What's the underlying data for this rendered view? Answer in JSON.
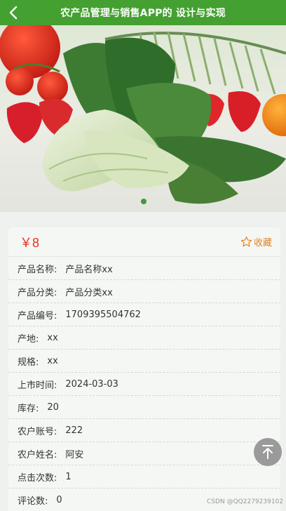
{
  "header": {
    "title": "农产品管理与销售APP的 设计与实现"
  },
  "product": {
    "price": "￥8",
    "favorite_label": "收藏"
  },
  "details": [
    {
      "label": "产品名称:",
      "value": "产品名称xx"
    },
    {
      "label": "产品分类:",
      "value": "产品分类xx"
    },
    {
      "label": "产品编号:",
      "value": "1709395504762"
    },
    {
      "label": "产地:",
      "value": "xx"
    },
    {
      "label": "规格:",
      "value": "xx"
    },
    {
      "label": "上市时间:",
      "value": "2024-03-03"
    },
    {
      "label": "库存:",
      "value": "20"
    },
    {
      "label": "农户账号:",
      "value": "222"
    },
    {
      "label": "农户姓名:",
      "value": "阿安"
    },
    {
      "label": "点击次数:",
      "value": "1"
    },
    {
      "label": "评论数:",
      "value": "0"
    }
  ],
  "watermark": "CSDN @QQ2279239102",
  "colors": {
    "header": "#43a031",
    "price": "#e5321e",
    "favorite": "#e0831f"
  },
  "icons": {
    "back": "chevron-left-icon",
    "favorite": "star-outline-icon",
    "to_top": "arrow-up-to-top-icon"
  }
}
